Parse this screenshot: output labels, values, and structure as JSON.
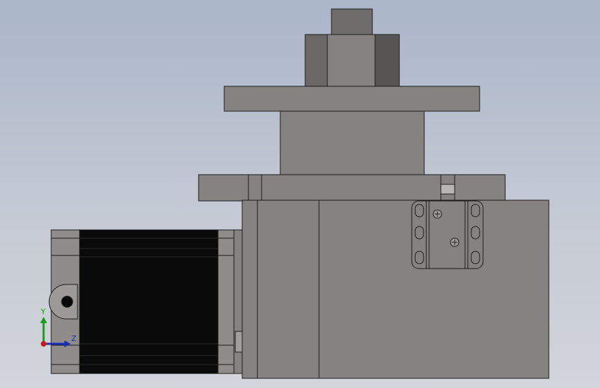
{
  "viewport": {
    "background_top": "#aab5c8",
    "background_bottom": "#d2d5da"
  },
  "model": {
    "body_color": "#858280",
    "body_dark": "#5e5b59",
    "motor_color": "#0a0a0a",
    "edge_color": "#1a1a1a"
  },
  "triad": {
    "y_label": "Y",
    "z_label": "Z",
    "y_color": "#1a9c1a",
    "z_color": "#1a2fb8",
    "x_color": "#c81a1a"
  }
}
